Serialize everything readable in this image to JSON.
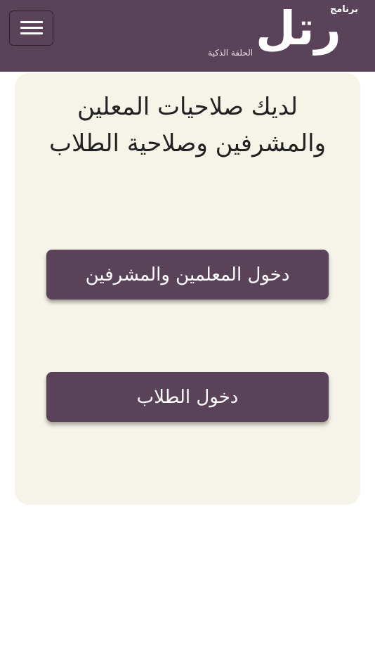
{
  "header": {
    "menu_icon": "hamburger-menu-icon",
    "logo": {
      "prefix": "برنامج",
      "name": "رتل",
      "tagline": "الحلقة الذكية"
    },
    "background_color": "#5a4358"
  },
  "card": {
    "heading": "لديك صلاحيات المعلين والمشرفين وصلاحية الطلاب",
    "background_color": "#f6f4e9"
  },
  "buttons": {
    "teachers_login": "دخول المعلمين والمشرفين",
    "students_login": "دخول الطلاب",
    "color": "#5a4358"
  }
}
